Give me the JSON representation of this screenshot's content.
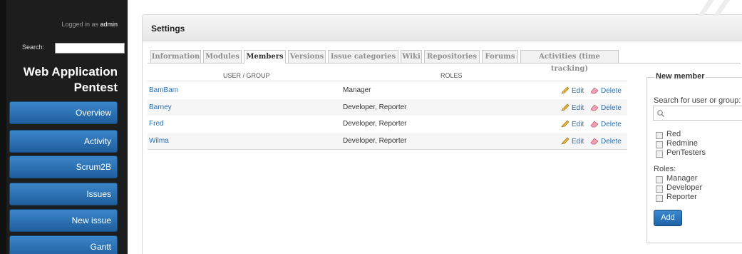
{
  "sidebar": {
    "logged_in_prefix": "Logged in as",
    "logged_in_user": "admin",
    "search_label": "Search:",
    "project_title": "Web Application Pentest",
    "nav": [
      "Overview",
      "Activity",
      "Scrum2B",
      "Issues",
      "New issue",
      "Gantt"
    ]
  },
  "main": {
    "title": "Settings",
    "tabs": [
      "Information",
      "Modules",
      "Members",
      "Versions",
      "Issue categories",
      "Wiki",
      "Repositories",
      "Forums",
      "Activities (time tracking)"
    ],
    "active_tab": "Members"
  },
  "members_table": {
    "headers": [
      "USER / GROUP",
      "ROLES"
    ],
    "edit_label": "Edit",
    "delete_label": "Delete",
    "rows": [
      {
        "user": "BamBam",
        "roles": "Manager"
      },
      {
        "user": "Barney",
        "roles": "Developer, Reporter"
      },
      {
        "user": "Fred",
        "roles": "Developer, Reporter"
      },
      {
        "user": "Wilma",
        "roles": "Developer, Reporter"
      }
    ]
  },
  "new_member": {
    "legend": "New member",
    "search_label": "Search for user or group:",
    "search_value": "",
    "principals": [
      "Red",
      "Redmine",
      "PenTesters"
    ],
    "roles_label": "Roles:",
    "roles": [
      "Manager",
      "Developer",
      "Reporter"
    ],
    "add_button": "Add"
  },
  "icons": {
    "edit": "pencil-icon",
    "delete": "eraser-icon",
    "search": "magnifier-icon"
  },
  "colors": {
    "link": "#2a6fb0",
    "nav_button": "#2d74b8",
    "sidebar_bg": "#1d1d1d"
  }
}
